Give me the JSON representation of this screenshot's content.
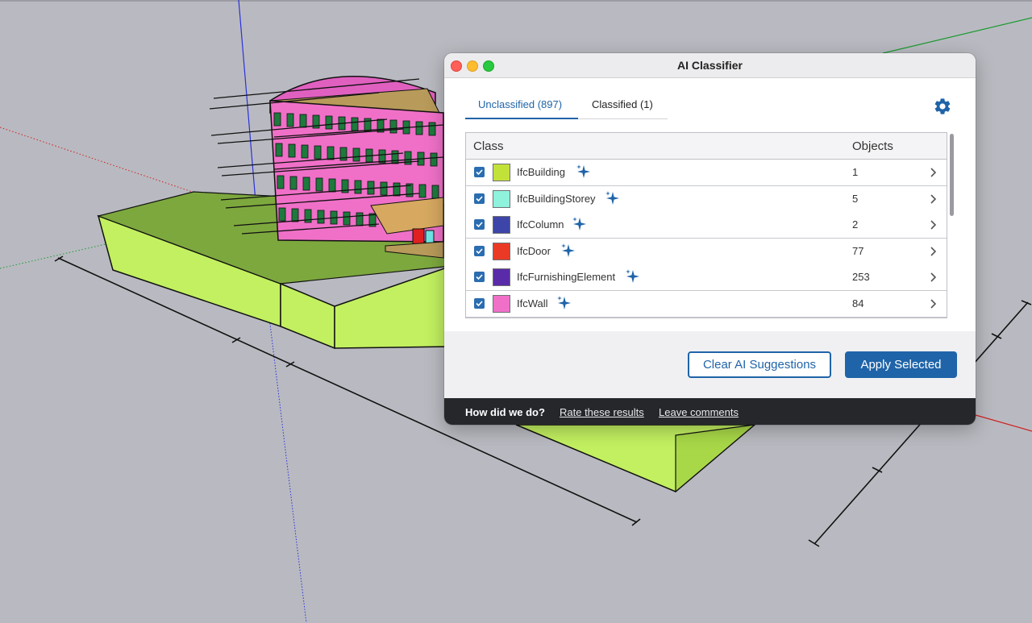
{
  "dialog": {
    "title": "AI Classifier",
    "tabs": [
      {
        "label": "Unclassified (897)",
        "active": true
      },
      {
        "label": "Classified (1)",
        "active": false
      }
    ],
    "settings_icon": "gear-icon",
    "table": {
      "columns": {
        "class": "Class",
        "objects": "Objects"
      },
      "rows": [
        {
          "name": "IfcBuilding",
          "color": "#c2e23a",
          "count": "1",
          "checked": true,
          "ai_suggested": true
        },
        {
          "name": "IfcBuildingStorey",
          "color": "#8ef2dc",
          "count": "5",
          "checked": true,
          "ai_suggested": true
        },
        {
          "name": "IfcColumn",
          "color": "#3d45a8",
          "count": "2",
          "checked": true,
          "ai_suggested": true
        },
        {
          "name": "IfcDoor",
          "color": "#ea3a26",
          "count": "77",
          "checked": true,
          "ai_suggested": true
        },
        {
          "name": "IfcFurnishingElement",
          "color": "#5a2ba8",
          "count": "253",
          "checked": true,
          "ai_suggested": true
        },
        {
          "name": "IfcWall",
          "color": "#f070c8",
          "count": "84",
          "checked": true,
          "ai_suggested": true
        }
      ]
    },
    "buttons": {
      "clear": "Clear AI Suggestions",
      "apply": "Apply Selected"
    },
    "feedback": {
      "question": "How did we do?",
      "rate": "Rate these results",
      "comments": "Leave comments"
    }
  },
  "colors": {
    "accent": "#1f64a8",
    "sparkle": "#1f64a8",
    "footer": "#25272b",
    "building_pink": "#f070c8",
    "ground_green": "#c2f060"
  }
}
